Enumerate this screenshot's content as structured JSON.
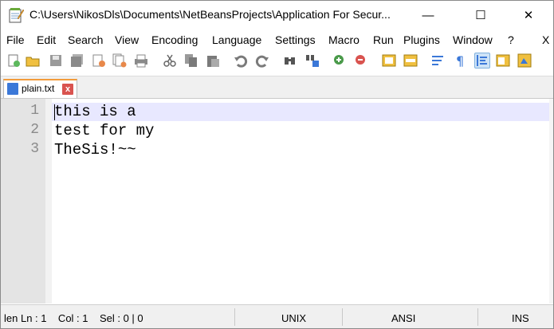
{
  "window": {
    "title": "C:\\Users\\NikosDls\\Documents\\NetBeansProjects\\Application For Secur...",
    "minimize": "—",
    "maximize": "☐",
    "close": "✕"
  },
  "menu": [
    "File",
    "Edit",
    "Search",
    "View",
    "Encoding",
    "Language",
    "Settings",
    "Macro",
    "Run",
    "Plugins",
    "Window",
    "?",
    "X"
  ],
  "toolbar": {
    "icons": [
      "new-file-icon",
      "open-file-icon",
      "save-icon",
      "save-all-icon",
      "close-icon",
      "close-all-icon",
      "print-icon",
      "cut-icon",
      "copy-icon",
      "paste-icon",
      "undo-icon",
      "redo-icon",
      "find-icon",
      "replace-icon",
      "zoom-in-icon",
      "zoom-out-icon",
      "sync-vertical-icon",
      "sync-horizontal-icon",
      "word-wrap-icon",
      "show-all-chars-icon",
      "indent-guide-icon",
      "doc-map-icon",
      "function-list-icon"
    ]
  },
  "tab": {
    "label": "plain.txt",
    "close": "x"
  },
  "editor": {
    "line_numbers": [
      "1",
      "2",
      "3"
    ],
    "lines": [
      "this is a",
      "test for my",
      "TheSis!~~"
    ]
  },
  "status": {
    "len_pos": "len Ln : 1    Col : 1    Sel : 0 | 0",
    "eol": "UNIX",
    "encoding": "ANSI",
    "mode": "INS"
  },
  "colors": {
    "accent": "#f39c3b",
    "current_line": "#e8e8ff",
    "gutter": "#e4e4e4"
  }
}
